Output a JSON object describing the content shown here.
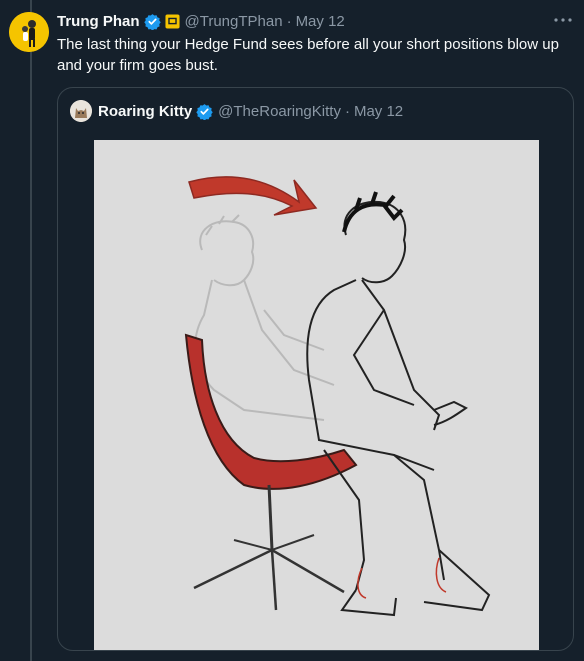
{
  "tweet": {
    "display_name": "Trung Phan",
    "handle": "@TrungTPhan",
    "separator": "·",
    "date": "May 12",
    "text": "The last thing your Hedge Fund sees before all your short positions blow up and your firm goes bust."
  },
  "quote": {
    "display_name": "Roaring Kitty",
    "handle": "@TheRoaringKitty",
    "separator": "·",
    "date": "May 12"
  },
  "colors": {
    "background": "#15202b",
    "verified_blue": "#1d9bf0",
    "affiliate_yellow": "#f5c400",
    "chair_red": "#b8312c",
    "arrow_red": "#c0392b"
  }
}
